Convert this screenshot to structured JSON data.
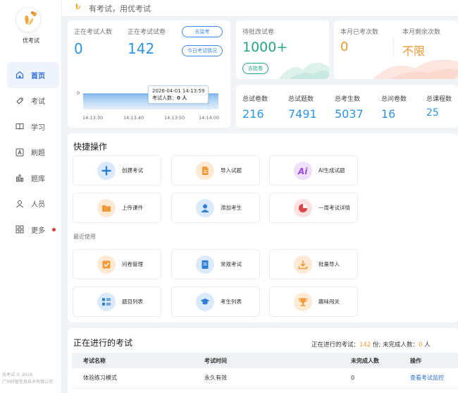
{
  "app": {
    "name": "优考试",
    "slogan": "有考试，用优考试",
    "copyright_line1": "优考试 © 2026",
    "copyright_line2": "广州好智信息技术有限公司"
  },
  "nav": [
    {
      "key": "home",
      "label": "首页",
      "icon": "home-icon",
      "active": true
    },
    {
      "key": "exam",
      "label": "考试",
      "icon": "tag-icon"
    },
    {
      "key": "study",
      "label": "学习",
      "icon": "book-icon"
    },
    {
      "key": "practice",
      "label": "刷题",
      "icon": "a-box-icon"
    },
    {
      "key": "bank",
      "label": "题库",
      "icon": "bar-chart-icon"
    },
    {
      "key": "people",
      "label": "人员",
      "icon": "user-icon"
    },
    {
      "key": "more",
      "label": "更多",
      "icon": "grid-icon",
      "badge": "red-dot"
    }
  ],
  "live": {
    "people_label": "正在考试人数",
    "people_value": "0",
    "papers_label": "正在考试试卷",
    "papers_value": "142",
    "monitor_button": "去监考",
    "today_button": "今日考试情况",
    "y_tick": "0",
    "x_ticks": [
      "14:13:30",
      "14:13:40",
      "14:13:50",
      "14:14:00"
    ],
    "tooltip_time": "2026-04-01 14:13:59",
    "tooltip_label": "考试人数：",
    "tooltip_value": "0 人"
  },
  "pending": {
    "label": "待批改试卷",
    "value": "1000+",
    "button": "去批卷"
  },
  "quota": {
    "used_label": "本月已考次数",
    "used_value": "0",
    "left_label": "本月剩余次数",
    "left_value": "不限"
  },
  "totals": [
    {
      "label": "总试卷数",
      "value": "216"
    },
    {
      "label": "总试题数",
      "value": "7491"
    },
    {
      "label": "总考生数",
      "value": "5037"
    },
    {
      "label": "总问卷数",
      "value": "16"
    },
    {
      "label": "总课程数",
      "value": "25"
    }
  ],
  "quick": {
    "title": "快捷操作",
    "items": [
      {
        "label": "创建考试",
        "icon": "plus-icon"
      },
      {
        "label": "导入试题",
        "icon": "document-icon"
      },
      {
        "label": "AI生成试题",
        "icon": "ai-icon"
      },
      {
        "label": "上传课件",
        "icon": "folder-icon"
      },
      {
        "label": "添加考生",
        "icon": "person-icon"
      },
      {
        "label": "一周考试详情",
        "icon": "pie-icon"
      }
    ],
    "recent_title": "最近使用",
    "recent": [
      {
        "label": "问卷管理",
        "icon": "checkbox-icon"
      },
      {
        "label": "常规考试",
        "icon": "notebook-icon"
      },
      {
        "label": "批量导入",
        "icon": "download-icon"
      },
      {
        "label": "题目列表",
        "icon": "list-icon"
      },
      {
        "label": "考生列表",
        "icon": "graduation-cap-icon"
      },
      {
        "label": "趣味闯关",
        "icon": "trophy-icon"
      }
    ]
  },
  "ongoing": {
    "title": "正在进行的考试",
    "summary_prefix": "正在进行的考试：",
    "summary_count": "142",
    "summary_unit": " 份;  未完成人数：",
    "summary_people": "0",
    "summary_people_unit": " 人",
    "columns": [
      "考试名称",
      "考试时间",
      "未完成人数",
      "操作"
    ],
    "rows": [
      {
        "name": "体验练习模式",
        "time": "永久有效",
        "unfinished": "0",
        "action": "查看考试监控"
      }
    ]
  },
  "colors": {
    "accent": "#2d6fd6",
    "blue_value": "#2b95e8",
    "green_value": "#23a783",
    "orange_value": "#f2962d",
    "red_dot": "#e03a3a"
  }
}
